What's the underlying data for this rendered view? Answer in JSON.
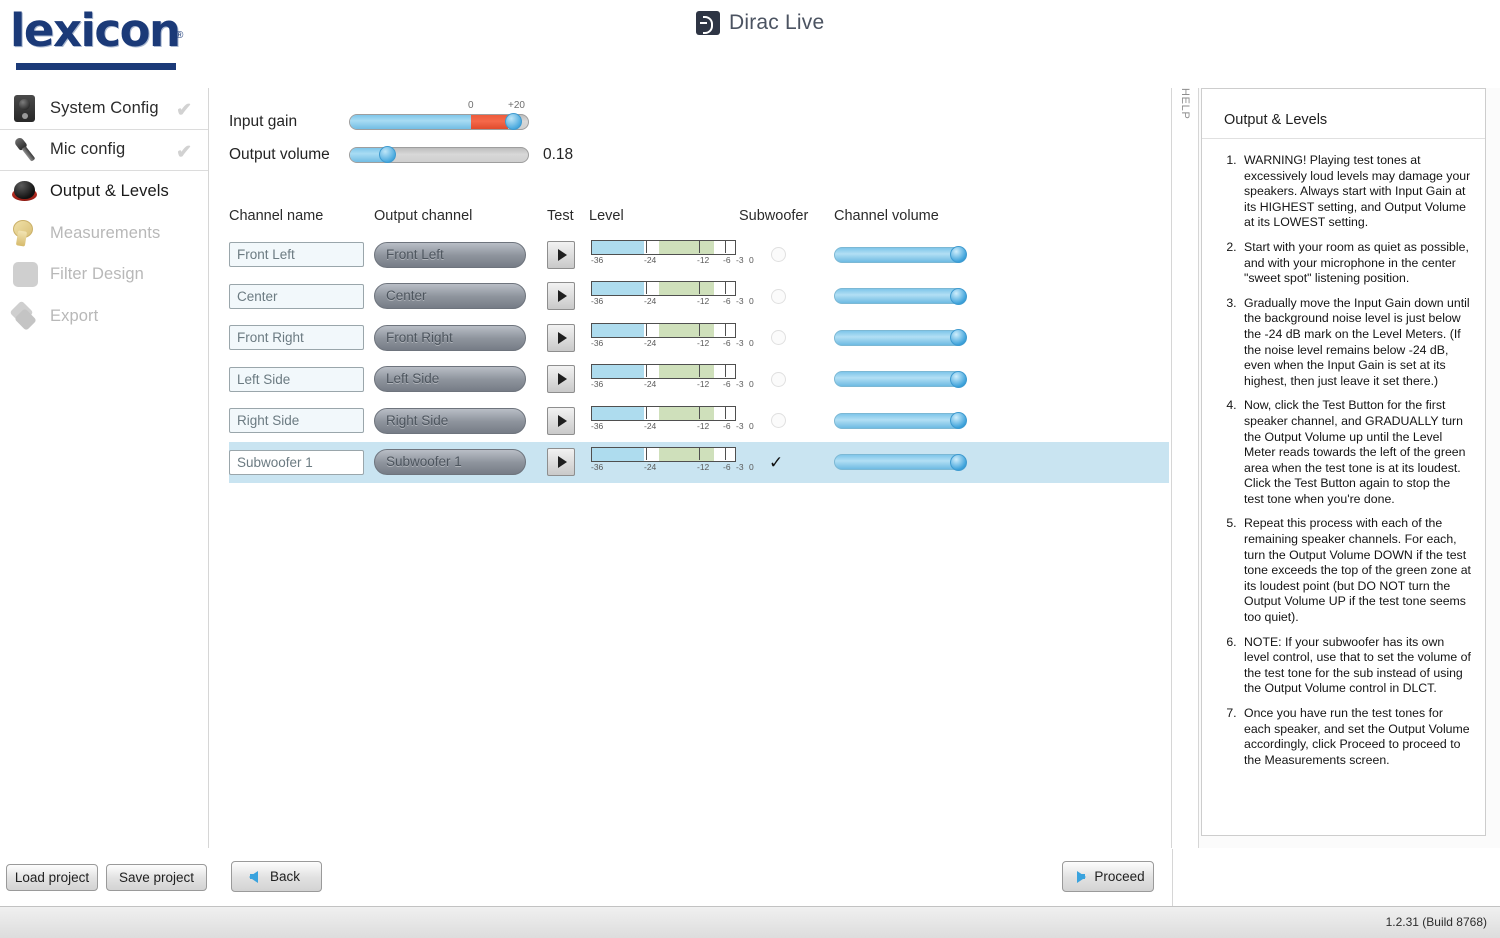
{
  "app": {
    "logo_text": "lexicon",
    "logo_reg": "®",
    "brand_name": "Dirac Live",
    "version": "1.2.31 (Build 8768)"
  },
  "sidebar": {
    "items": [
      {
        "label": "System Config",
        "icon": "speaker-icon",
        "state": "done",
        "check": "✔"
      },
      {
        "label": "Mic config",
        "icon": "microphone-icon",
        "state": "done",
        "check": "✔"
      },
      {
        "label": "Output & Levels",
        "icon": "volume-knob-icon",
        "state": "active",
        "check": ""
      },
      {
        "label": "Measurements",
        "icon": "tape-measure-icon",
        "state": "disabled",
        "check": ""
      },
      {
        "label": "Filter Design",
        "icon": "filter-icon",
        "state": "disabled",
        "check": ""
      },
      {
        "label": "Export",
        "icon": "export-icon",
        "state": "disabled",
        "check": ""
      }
    ]
  },
  "gain": {
    "input_gain_label": "Input gain",
    "input_gain_scale_zero": "0",
    "input_gain_scale_max": "+20",
    "output_volume_label": "Output volume",
    "output_volume_value": "0.18"
  },
  "table": {
    "headers": {
      "channel_name": "Channel name",
      "output_channel": "Output channel",
      "test": "Test",
      "level": "Level",
      "subwoofer": "Subwoofer",
      "channel_volume": "Channel volume"
    },
    "level_ticks": [
      "-36",
      "-24",
      "-12",
      "-6",
      "-3",
      "0"
    ],
    "rows": [
      {
        "name": "Front Left",
        "output": "Front Left",
        "subwoofer": false,
        "selected": false
      },
      {
        "name": "Center",
        "output": "Center",
        "subwoofer": false,
        "selected": false
      },
      {
        "name": "Front Right",
        "output": "Front Right",
        "subwoofer": false,
        "selected": false
      },
      {
        "name": "Left Side",
        "output": "Left Side",
        "subwoofer": false,
        "selected": false
      },
      {
        "name": "Right Side",
        "output": "Right Side",
        "subwoofer": false,
        "selected": false
      },
      {
        "name": "Subwoofer 1",
        "output": "Subwoofer 1",
        "subwoofer": true,
        "selected": true
      }
    ],
    "sub_check_mark": "✓"
  },
  "help": {
    "tab_label": "HELP",
    "title": "Output & Levels",
    "items": [
      "WARNING! Playing test tones at excessively loud levels may damage your speakers. Always start with Input Gain at its HIGHEST setting, and Output Volume at its LOWEST setting.",
      "Start with your room as quiet as possible, and with your microphone in the center \"sweet spot\" listening position.",
      "Gradually move the Input Gain down until the background noise level is just below the -24 dB mark on the Level Meters. (If the noise level remains below -24 dB, even when the Input Gain is set at its highest, then just leave it set there.)",
      "Now, click the Test Button for the first speaker channel, and GRADUALLY turn the Output Volume up until the Level Meter reads towards the left of the green area when the test tone is at its loudest. Click the Test Button again to stop the test tone when you're done.",
      "Repeat this process with each of the remaining speaker channels. For each, turn the Output Volume DOWN if the test tone exceeds the top of the green zone at its loudest point (but DO NOT turn the Output Volume UP if the test tone seems too quiet).",
      "NOTE: If your subwoofer has its own level control, use that to set the volume of the test tone for the sub instead of using the Output Volume control in DLCT.",
      "Once you have run the test tones for each speaker, and set the Output Volume accordingly, click Proceed to proceed to the Measurements screen."
    ]
  },
  "footer": {
    "load_project": "Load project",
    "save_project": "Save project",
    "back": "Back",
    "proceed": "Proceed"
  },
  "colors": {
    "brand_blue": "#1b3a78",
    "accent_blue": "#3aa3de",
    "slider_red": "#ef5c3c",
    "row_highlight": "#c9e4f1",
    "meter_green": "#cfe0bb",
    "meter_blue": "#aedcee"
  }
}
